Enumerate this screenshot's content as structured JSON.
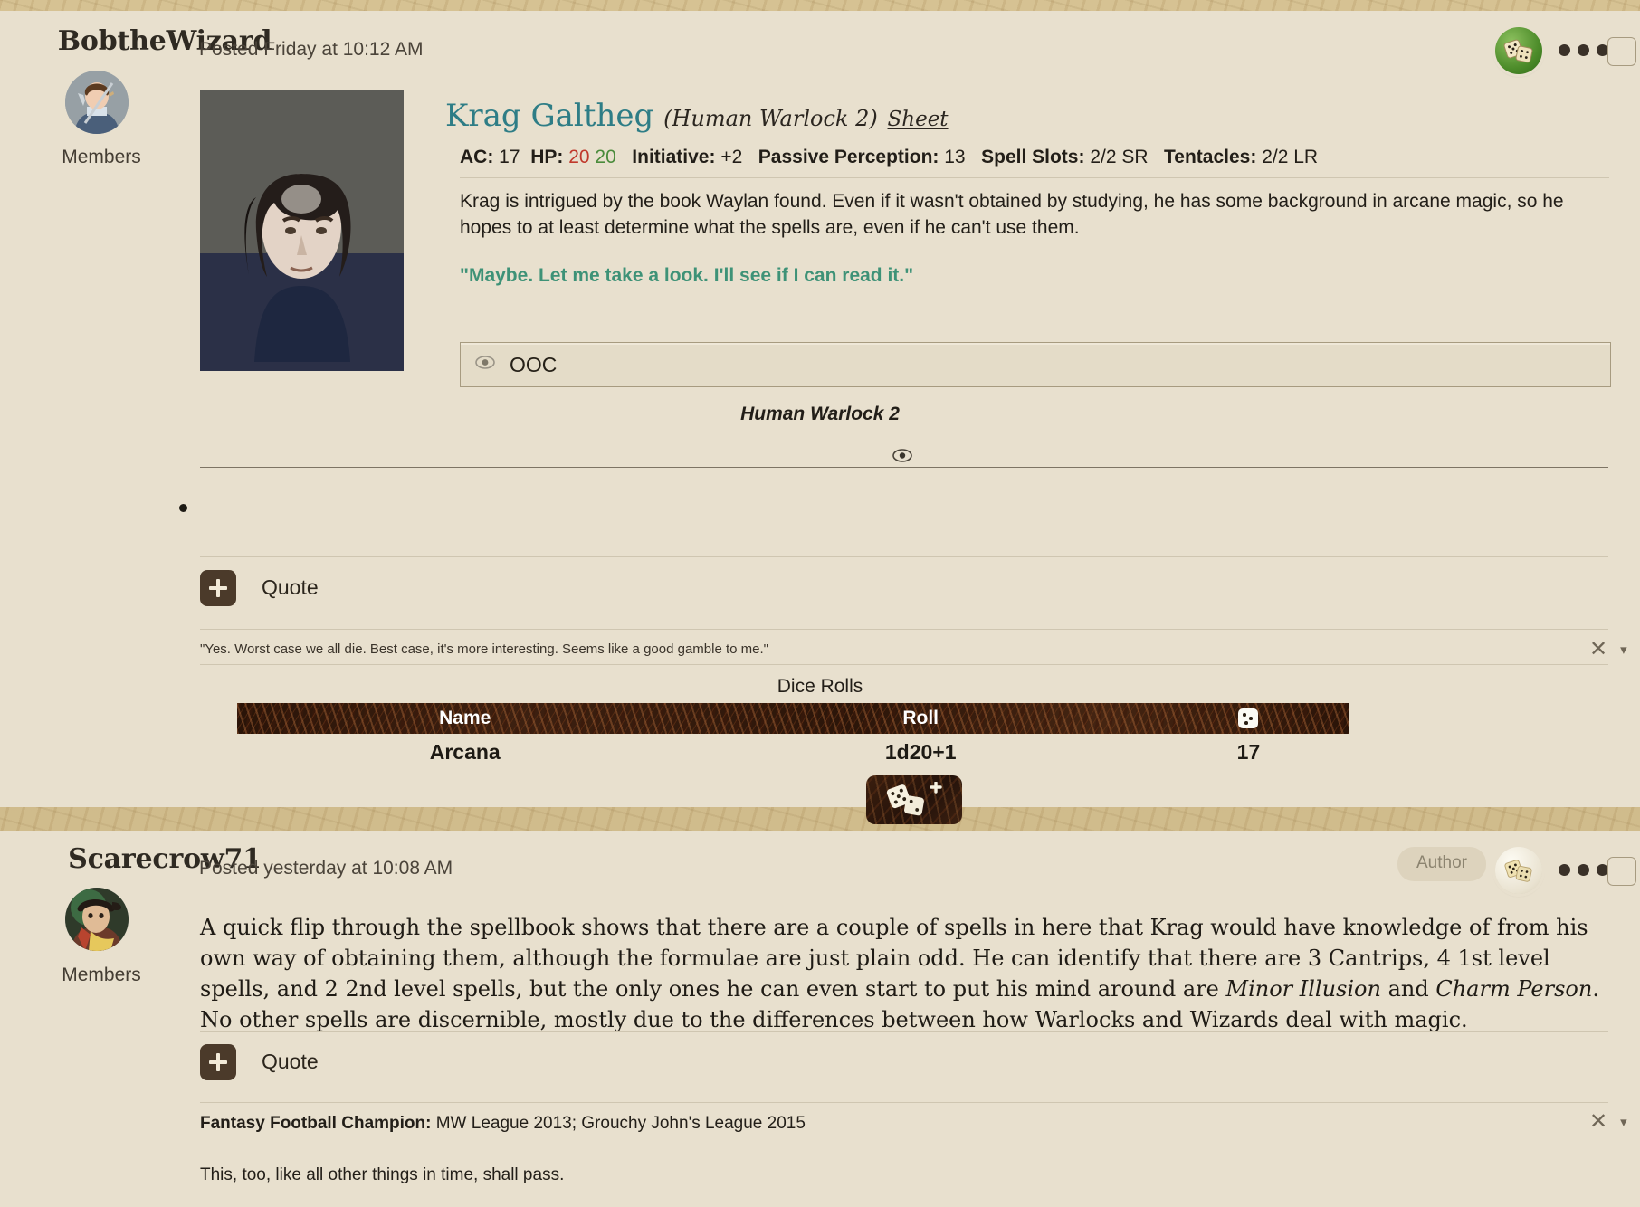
{
  "posts": [
    {
      "username": "BobtheWizard",
      "group": "Members",
      "posted": "Posted Friday at 10:12 AM",
      "character": {
        "name": "Krag Galtheg",
        "race": "(Human Warlock 2)",
        "sheet_link": "Sheet"
      },
      "stats": [
        {
          "label": "AC:",
          "value": "17"
        },
        {
          "label": "HP:",
          "value": "20 20"
        },
        {
          "label": "Initiative:",
          "value": "+2"
        },
        {
          "label": "Passive Perception:",
          "value": "13"
        },
        {
          "label": "Spell Slots:",
          "value": "2/2 SR"
        },
        {
          "label": "Tentacles:",
          "value": "2/2 LR"
        }
      ],
      "hp_current": "20",
      "hp_max": "20",
      "body": "Krag is intrigued by the book Waylan found. Even if it wasn't obtained by studying, he has some background in arcane magic, so he hopes to at least determine what the spells are, even if he can't use them.",
      "dialogue": "\"Maybe. Let me take a look. I'll see if I can read it.\"",
      "spoiler_label": "OOC",
      "signature_caption": "Human Warlock 2",
      "quote_label": "Quote",
      "signature_text": "\"Yes. Worst case we all die. Best case, it's more interesting. Seems like a good gamble to me.\"",
      "dice": {
        "title": "Dice Rolls",
        "columns": [
          "Name",
          "Roll",
          "die-icon"
        ],
        "rows": [
          {
            "name": "Arcana",
            "roll": "1d20+1",
            "result": "17"
          }
        ]
      }
    },
    {
      "username": "Scarecrow71",
      "group": "Members",
      "posted": "Posted yesterday at 10:08 AM",
      "author_badge": "Author",
      "body_parts": [
        {
          "text": "A quick flip through the spellbook shows that there are a couple of spells in here that Krag would have knowledge of from his own way of obtaining them, although the formulae are just plain odd.  He can identify that there are 3 Cantrips, 4 1st level spells, and 2 2nd level spells, but the only ones he can even start to put his mind around are ",
          "style": "normal"
        },
        {
          "text": "Minor Illusion",
          "style": "italic"
        },
        {
          "text": " and ",
          "style": "normal"
        },
        {
          "text": "Charm Person",
          "style": "italic"
        },
        {
          "text": ".  No other spells are discernible, mostly due to the differences between how Warlocks and Wizards deal with magic.",
          "style": "normal"
        }
      ],
      "quote_label": "Quote",
      "signature_bold_label": "Fantasy Football Champion:",
      "signature_bold_value": " MW League 2013; Grouchy John's League 2015",
      "signature_text": "This, too, like all other things in time, shall pass."
    }
  ],
  "icons": {
    "eye": "eye-icon",
    "dice": "dice-icon",
    "ellipsis": "more-options-icon",
    "plus": "plus-icon",
    "close": "✕",
    "caret": "▾"
  },
  "colors": {
    "page_bg": "#cdb888",
    "post_bg": "#e8e0ce",
    "char_name": "#2e7d86",
    "dialogue_green": "#3e9277",
    "hp_red": "#c0392b",
    "hp_green": "#4a8b3b",
    "dice_header": "#2a1408"
  }
}
